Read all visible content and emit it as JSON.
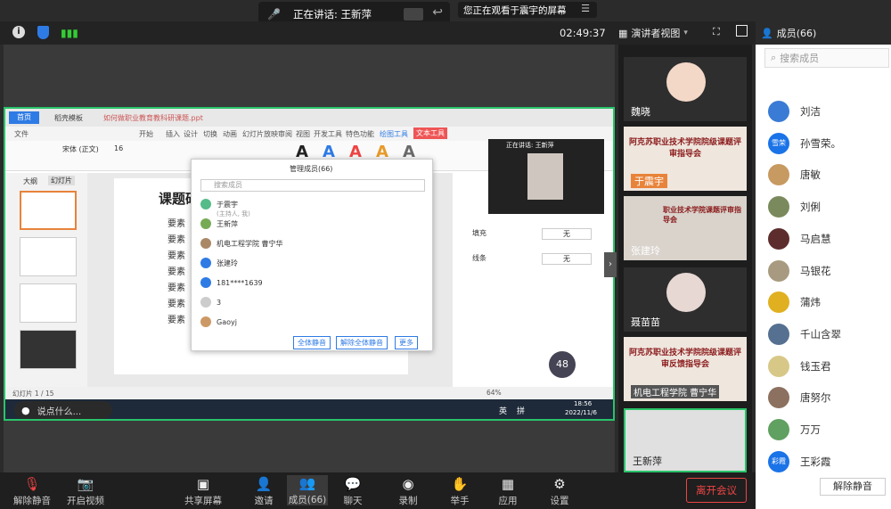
{
  "speaking_pill": {
    "label": "正在讲话: 王新萍"
  },
  "viewing_pill": {
    "label": "您正在观看于震宇的屏幕"
  },
  "timer": "02:49:37",
  "view_mode": "演讲者视图",
  "members_header": "成员(66)",
  "search_placeholder": "搜索成员",
  "members": [
    "刘洁",
    "孙雪荣。",
    "唐敏",
    "刘俐",
    "马启慧",
    "马银花",
    "蒲炜",
    "千山含翠",
    "钱玉君",
    "唐努尔",
    "万万",
    "王彩霞"
  ],
  "members_avatars": [
    "#3a7bd5",
    "#1b73e8",
    "#c79a61",
    "#7a8a5d",
    "#5d2d2d",
    "#a89a80",
    "#e0b020",
    "#557090",
    "#d8c888",
    "#8c7060",
    "#60a060",
    "#1b73e8"
  ],
  "members_avatar_text": [
    "",
    "雪荣",
    "",
    "",
    "",
    "",
    "",
    "",
    "",
    "",
    "",
    "彩霞"
  ],
  "unmute_all": "解除静音",
  "video_tiles": [
    "魏晓",
    "于震宇",
    "张建玲",
    "聂苗苗",
    "机电工程学院 曹宁华",
    "王新萍"
  ],
  "tile2_text": "阿克苏职业技术学院院级课题评审指导会",
  "tile3_text": "职业技术学院课题评审指导会",
  "tile5_text": "阿克苏职业技术学院院级课题评审反馈指导会",
  "shared": {
    "tabs": [
      "首页",
      "稻壳模板",
      "如何做职业教育教科研课题.ppt"
    ],
    "menu": [
      "文件",
      "开始",
      "插入",
      "设计",
      "切换",
      "动画",
      "幻灯片放映",
      "审阅",
      "视图",
      "开发工具",
      "特色功能",
      "绘图工具",
      "文本工具"
    ],
    "font_name": "宋体 (正文)",
    "font_size": "16",
    "outline_label": "大纲",
    "slides_label": "幻灯片",
    "slide_title": "课题研",
    "bullet": "要素",
    "panel_title": "管理成员(66)",
    "panel_search": "搜索成员",
    "panel_members": [
      "于震宇",
      "王新萍",
      "机电工程学院 曹宁华",
      "张建玲",
      "181****1639",
      "3",
      "Gaoyj"
    ],
    "panel_host_note": "(主持人, 我)",
    "panel_buttons": [
      "全体静音",
      "解除全体静音",
      "更多"
    ],
    "float_label": "正在讲话: 王新萍",
    "fill_label": "填充",
    "line_label": "线条",
    "none_label": "无",
    "speed": "48",
    "status": "幻灯片 1 / 15",
    "zoom": "64%",
    "time": "18:56",
    "date": "2022/11/6",
    "comment": "说点什么...",
    "ime1": "英",
    "ime2": "拼"
  },
  "bottom": [
    {
      "label": "解除静音",
      "icon": "mic-off"
    },
    {
      "label": "开启视频",
      "icon": "camera-off"
    },
    {
      "label": "共享屏幕",
      "icon": "share"
    },
    {
      "label": "邀请",
      "icon": "invite"
    },
    {
      "label": "成员(66)",
      "icon": "members"
    },
    {
      "label": "聊天",
      "icon": "chat"
    },
    {
      "label": "录制",
      "icon": "record"
    },
    {
      "label": "举手",
      "icon": "hand"
    },
    {
      "label": "应用",
      "icon": "apps"
    },
    {
      "label": "设置",
      "icon": "gear"
    }
  ],
  "leave": "离开会议"
}
